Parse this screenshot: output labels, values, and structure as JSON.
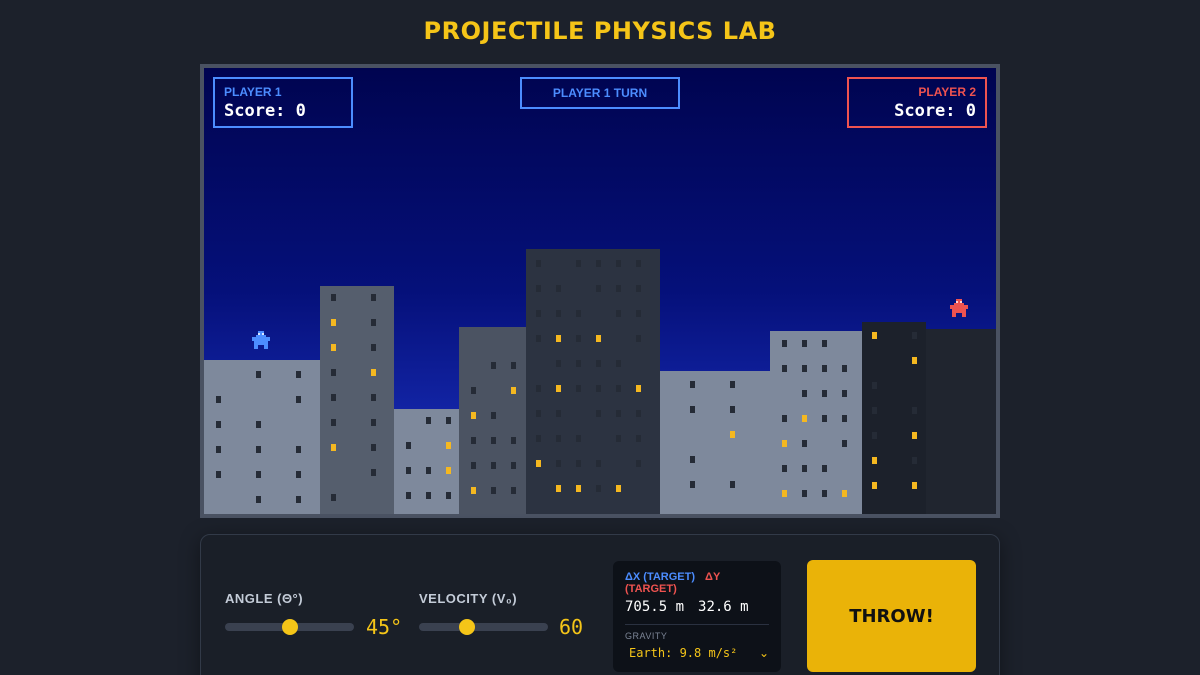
{
  "app": {
    "title": "PROJECTILE PHYSICS LAB"
  },
  "players": {
    "p1": {
      "label": "PLAYER 1",
      "score_text": "Score: 0",
      "color": "#4c8dff"
    },
    "p2": {
      "label": "PLAYER 2",
      "score_text": "Score: 0",
      "color": "#ef5350"
    }
  },
  "turn": {
    "text": "PLAYER 1 TURN"
  },
  "controls": {
    "angle": {
      "label": "ANGLE (Θ°)",
      "value_text": "45°",
      "value": 45
    },
    "velocity": {
      "label": "VELOCITY (V₀)",
      "value_text": "60",
      "value": 60
    }
  },
  "info": {
    "dx_label": "ΔX (TARGET)",
    "dy_label": "ΔY (TARGET)",
    "dx_value": "705.5 m",
    "dy_value": "32.6 m",
    "gravity_label": "GRAVITY",
    "gravity_selected": "Earth: 9.8 m/s²"
  },
  "actions": {
    "throw_label": "THROW!"
  },
  "colors": {
    "accent": "#f5c518",
    "player1": "#4c8dff",
    "player2": "#ef5350",
    "sky_top": "#000450",
    "sky_bottom": "#1d34c8",
    "window_lit": "#f5b820"
  }
}
